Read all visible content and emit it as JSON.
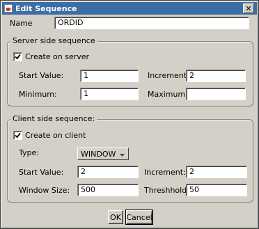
{
  "window": {
    "title": "Edit Sequence"
  },
  "name_field": {
    "label": "Name",
    "value": "ORDID"
  },
  "server": {
    "group_title": "Server side sequence",
    "create_label": "Create on server",
    "create_checked": true,
    "start_label": "Start Value:",
    "start_value": "1",
    "increment_label": "Increment:",
    "increment_value": "2",
    "minimum_label": "Minimum:",
    "minimum_value": "1",
    "maximum_label": "Maximum:",
    "maximum_value": ""
  },
  "client": {
    "group_title": "Client side sequence:",
    "create_label": "Create on client",
    "create_checked": true,
    "type_label": "Type:",
    "type_value": "WINDOW",
    "start_label": "Start Value:",
    "start_value": "2",
    "increment_label": "Increment:",
    "increment_value": "2",
    "window_size_label": "Window Size:",
    "window_size_value": "500",
    "threshold_label": "Threshhold:",
    "threshold_value": "50"
  },
  "buttons": {
    "ok": "OK",
    "cancel": "Cancel"
  },
  "icons": {
    "app": "java-cup-icon",
    "close": "close-icon",
    "check": "checkmark-icon",
    "dropdown": "dropdown-arrow-icon"
  },
  "colors": {
    "titlebar": "#3b6ea5",
    "face": "#d4d0c8"
  }
}
